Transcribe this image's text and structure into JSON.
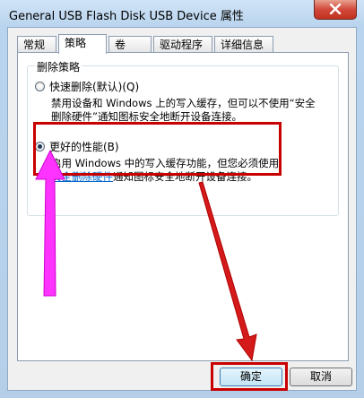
{
  "window": {
    "title": "General USB Flash Disk USB Device 属性"
  },
  "tabs": [
    {
      "label": "常规"
    },
    {
      "label": "策略"
    },
    {
      "label": "卷"
    },
    {
      "label": "驱动程序"
    },
    {
      "label": "详细信息"
    }
  ],
  "policy": {
    "group_title": "删除策略",
    "quick_removal": {
      "label": "快速删除(默认)(Q)",
      "desc_line1": "禁用设备和 Windows 上的写入缓存，但可以不使用“安全",
      "desc_line2": "删除硬件”通知图标安全地断开设备连接。"
    },
    "better_performance": {
      "label": "更好的性能(B)",
      "desc_line1": "启用 Windows 中的写入缓存功能，但您必须使用",
      "desc_link": "安全删除硬件",
      "desc_line2_rest": "通知图标安全地断开设备连接。"
    }
  },
  "buttons": {
    "ok": "确定",
    "cancel": "取消"
  },
  "colors": {
    "highlight": "#c80000",
    "arrow": "#ff33ff"
  }
}
